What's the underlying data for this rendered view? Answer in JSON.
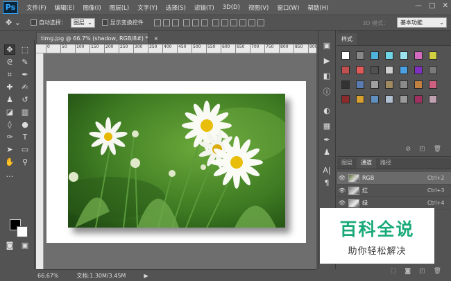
{
  "app": {
    "logo_text": "Ps"
  },
  "menu": [
    "文件(F)",
    "编辑(E)",
    "图像(I)",
    "图层(L)",
    "文字(Y)",
    "选择(S)",
    "滤镜(T)",
    "3D(D)",
    "视图(V)",
    "窗口(W)",
    "帮助(H)"
  ],
  "window_controls": {
    "minimize": "—",
    "maximize": "□",
    "close": "✕"
  },
  "options": {
    "auto_select_label": "自动选择：",
    "auto_select_value": "图层",
    "show_transform_label": "显示变换控件",
    "mode3d_label": "3D 模式：",
    "workspace_value": "基本功能"
  },
  "document": {
    "tab_title": "timg.jpg @ 66.7% (shadow, RGB/8#) *",
    "tab_close": "×",
    "ruler_ticks": [
      "0",
      "50",
      "100",
      "150",
      "200",
      "250",
      "300",
      "350",
      "400",
      "450",
      "500",
      "550",
      "600",
      "650",
      "700",
      "750",
      "800",
      "850",
      "900",
      "950"
    ]
  },
  "status": {
    "zoom": "66.67%",
    "doc_info": "文档:1.30M/3.45M",
    "arrow": "▶"
  },
  "styles_panel": {
    "tab": "样式"
  },
  "channels_panel": {
    "tabs": [
      "图层",
      "通道",
      "路径"
    ],
    "rows": [
      {
        "name": "RGB",
        "shortcut": "Ctrl+2"
      },
      {
        "name": "红",
        "shortcut": "Ctrl+3"
      },
      {
        "name": "绿",
        "shortcut": "Ctrl+4"
      }
    ]
  },
  "watermark": {
    "title": "百科全说",
    "subtitle": "助你轻松解决"
  },
  "colors": {
    "accent": "#31a8ff",
    "watermark_green": "#1aaa7a",
    "foreground": "#000000",
    "background": "#ffffff"
  },
  "swatch_colors": [
    "#ffffff",
    "#888888",
    "#4fb3d9",
    "#6fd6e8",
    "#9be3ef",
    "#d46ac0",
    "#d0d040",
    "#c05050",
    "#e05a5a",
    "#505050",
    "#cfcfcf",
    "#4aa0e0",
    "#8030c0",
    "#7a7a7a",
    "#333333",
    "#5a7ab0",
    "#a0a0a0",
    "#a08a60",
    "#8a8a8a",
    "#c08040",
    "#d06080",
    "#8a2a2a",
    "#d8a030",
    "#6090c0",
    "#b0c0d0",
    "#9a9a9a",
    "#a03060",
    "#c0a0b0"
  ]
}
